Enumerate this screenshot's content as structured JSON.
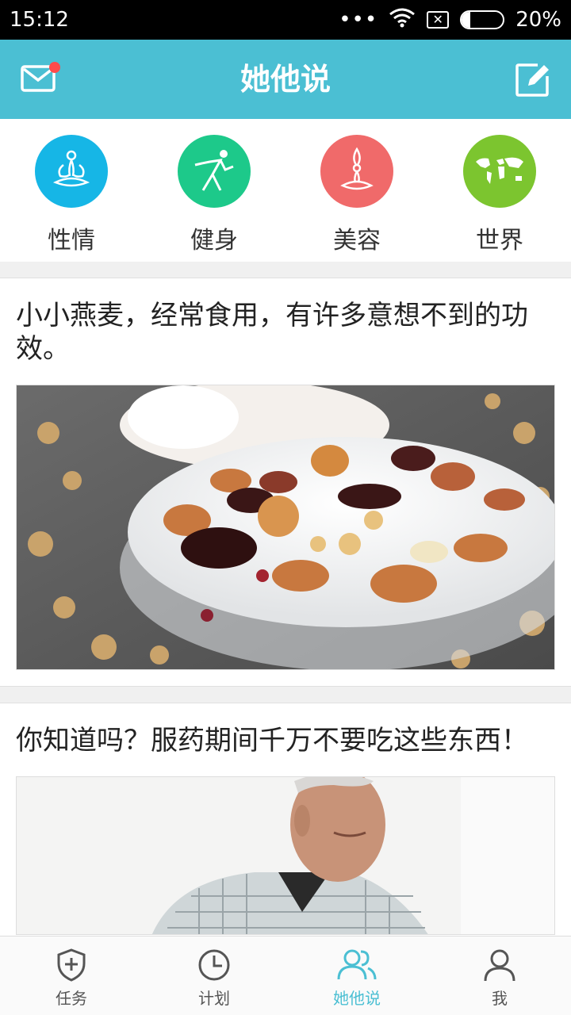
{
  "status_bar": {
    "time": "15:12",
    "dots": "•••",
    "battery_text": "20%",
    "battery_level": 0.2
  },
  "app_bar": {
    "title": "她他说",
    "left_icon": "mail-icon",
    "right_icon": "edit-icon",
    "accent": "#4bbfd3"
  },
  "categories": [
    {
      "label": "性情",
      "icon": "meditation-icon",
      "color": "#16b6e6"
    },
    {
      "label": "健身",
      "icon": "fitness-icon",
      "color": "#1dc98a"
    },
    {
      "label": "美容",
      "icon": "yoga-icon",
      "color": "#f06a6a"
    },
    {
      "label": "世界",
      "icon": "world-map-icon",
      "color": "#7cc52f"
    }
  ],
  "articles": [
    {
      "title": "小小燕麦，经常食用，有许多意想不到的功效。",
      "image": "oatmeal-bowl-image"
    },
    {
      "title": "你知道吗？服药期间千万不要吃这些东西！",
      "image": "elderly-man-image"
    }
  ],
  "bottom_nav": [
    {
      "label": "任务",
      "icon": "shield-plus-icon",
      "active": false
    },
    {
      "label": "计划",
      "icon": "clock-icon",
      "active": false
    },
    {
      "label": "她他说",
      "icon": "people-icon",
      "active": true
    },
    {
      "label": "我",
      "icon": "person-icon",
      "active": false
    }
  ]
}
